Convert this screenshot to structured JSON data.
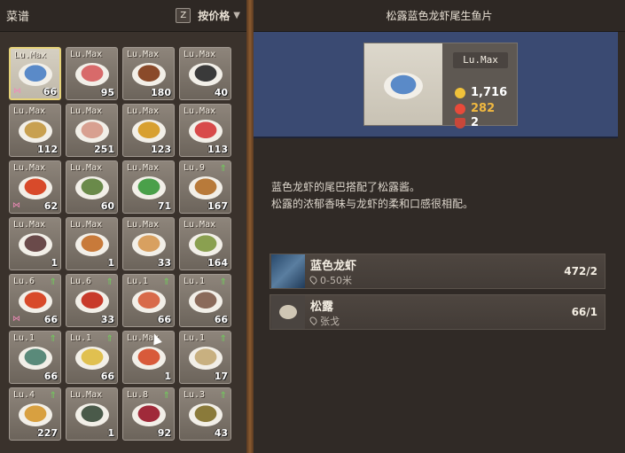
{
  "left_panel": {
    "title": "菜谱",
    "sort_key": "Z",
    "sort_label": "按价格"
  },
  "recipes": [
    {
      "lv": "Lu.Max",
      "count": "66",
      "bow": true,
      "selected": true,
      "color": "#5a8ac8"
    },
    {
      "lv": "Lu.Max",
      "count": "95",
      "color": "#d86a6a"
    },
    {
      "lv": "Lu.Max",
      "count": "180",
      "color": "#8a4a2a"
    },
    {
      "lv": "Lu.Max",
      "count": "40",
      "color": "#3a3a3a"
    },
    {
      "lv": "Lu.Max",
      "count": "112",
      "color": "#c8a050"
    },
    {
      "lv": "Lu.Max",
      "count": "251",
      "color": "#d8a090"
    },
    {
      "lv": "Lu.Max",
      "count": "123",
      "color": "#d8a030"
    },
    {
      "lv": "Lu.Max",
      "count": "113",
      "color": "#d84a4a"
    },
    {
      "lv": "Lu.Max",
      "count": "62",
      "bow": true,
      "color": "#d84a2a"
    },
    {
      "lv": "Lu.Max",
      "count": "60",
      "color": "#6a8a4a"
    },
    {
      "lv": "Lu.Max",
      "count": "71",
      "color": "#4aa04a"
    },
    {
      "lv": "Lu.9",
      "count": "167",
      "up": true,
      "color": "#b87a3a"
    },
    {
      "lv": "Lu.Max",
      "count": "1",
      "color": "#6a4a4a"
    },
    {
      "lv": "Lu.Max",
      "count": "1",
      "color": "#c87a3a"
    },
    {
      "lv": "Lu.Max",
      "count": "33",
      "color": "#d8a060"
    },
    {
      "lv": "Lu.Max",
      "count": "164",
      "color": "#8aa050"
    },
    {
      "lv": "Lu.6",
      "count": "66",
      "up": true,
      "bow": true,
      "color": "#d84a2a"
    },
    {
      "lv": "Lu.6",
      "count": "33",
      "up": true,
      "color": "#c83a2a"
    },
    {
      "lv": "Lu.1",
      "count": "66",
      "up": true,
      "color": "#d86a4a"
    },
    {
      "lv": "Lu.1",
      "count": "66",
      "up": true,
      "color": "#8a6a5a"
    },
    {
      "lv": "Lu.1",
      "count": "66",
      "up": true,
      "color": "#5a8a7a"
    },
    {
      "lv": "Lu.1",
      "count": "66",
      "up": true,
      "color": "#e0c050"
    },
    {
      "lv": "Lu.Max",
      "count": "1",
      "color": "#d85a3a"
    },
    {
      "lv": "Lu.1",
      "count": "17",
      "up": true,
      "color": "#c8b080"
    },
    {
      "lv": "Lu.4",
      "count": "227",
      "up": true,
      "color": "#d8a040"
    },
    {
      "lv": "Lu.Max",
      "count": "1",
      "color": "#4a5a4a"
    },
    {
      "lv": "Lu.8",
      "count": "92",
      "up": true,
      "color": "#a02a3a"
    },
    {
      "lv": "Lu.3",
      "count": "43",
      "up": true,
      "color": "#8a7a3a"
    }
  ],
  "detail": {
    "title": "松露蓝色龙虾尾生鱼片",
    "level": "Lu.Max",
    "price": "1,716",
    "rating": "282",
    "bowls": "2",
    "dish_color": "#5a8ac8",
    "description_line1": "蓝色龙虾的尾巴搭配了松露酱。",
    "description_line2": "松露的浓郁香味与龙虾的柔和口感很相配。"
  },
  "ingredients": [
    {
      "name": "蓝色龙虾",
      "location": "0-50米",
      "count": "472/2"
    },
    {
      "name": "松露",
      "location": "张戈",
      "count": "66/1"
    }
  ],
  "colors": {
    "accent": "#e6d37a",
    "banner": "#3a4a72",
    "level_up": "#6fcf5a",
    "rating": "#f0b840"
  }
}
